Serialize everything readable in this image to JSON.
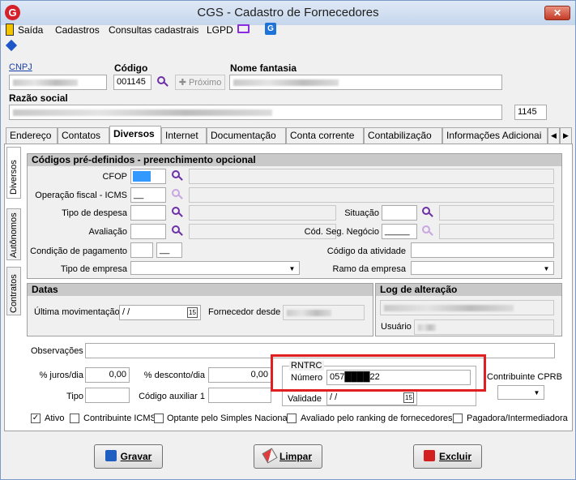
{
  "window": {
    "title": "CGS - Cadastro de Fornecedores",
    "close_label": "✕",
    "logo_letter": "G"
  },
  "menu": {
    "items": [
      "Saída",
      "Cadastros",
      "Consultas cadastrais",
      "LGPD"
    ]
  },
  "header": {
    "cnpj_label": "CNPJ",
    "codigo_label": "Código",
    "codigo_value": "001145",
    "proximo_label": "Próximo",
    "nome_fantasia_label": "Nome fantasia",
    "razao_social_label": "Razão social",
    "razao_code": "1145"
  },
  "tabs": [
    "Endereço",
    "Contatos",
    "Diversos",
    "Internet",
    "Documentação",
    "Conta corrente",
    "Contabilização",
    "Informações Adicionai"
  ],
  "side_tabs": [
    "Diversos",
    "Autônomos",
    "Contratos"
  ],
  "codigos": {
    "title": "Códigos pré-definidos - preenchimento opcional",
    "cfop": "CFOP",
    "operacao": "Operação fiscal - ICMS",
    "tipo_despesa": "Tipo de despesa",
    "avaliacao": "Avaliação",
    "condicao": "Condição de pagamento",
    "tipo_empresa": "Tipo de empresa",
    "situacao": "Situação",
    "cod_seg": "Cód. Seg. Negócio",
    "cod_atividade": "Código da atividade",
    "ramo": "Ramo da empresa"
  },
  "datas": {
    "title": "Datas",
    "ultima": "Última movimentação",
    "ultima_value": " /  /",
    "fornecedor_desde": "Fornecedor desde"
  },
  "log": {
    "title": "Log de alteração",
    "usuario": "Usuário"
  },
  "obs_label": "Observações",
  "juros_label": "% juros/dia",
  "juros_value": "0,00",
  "desconto_label": "% desconto/dia",
  "desconto_value": "0,00",
  "tipo_label": "Tipo",
  "cod_aux_label": "Código auxiliar 1",
  "rntrc": {
    "title": "RNTRC",
    "numero_label": "Número",
    "numero_value": "057████22",
    "validade_label": "Validade",
    "validade_value": " /  /"
  },
  "contribuinte_cprb": "Contribuinte CPRB",
  "checks": [
    {
      "label": "Ativo",
      "checked": true
    },
    {
      "label": "Contribuinte ICMS",
      "checked": false
    },
    {
      "label": "Optante pelo Simples Nacional",
      "checked": false
    },
    {
      "label": "Avaliado pelo ranking de fornecedores",
      "checked": false
    },
    {
      "label": "Pagadora/Intermediadora",
      "checked": false
    }
  ],
  "buttons": {
    "gravar": "Gravar",
    "limpar": "Limpar",
    "excluir": "Excluir"
  },
  "colors": {
    "highlight": "#e02020",
    "accent": "#6b2fa6",
    "cfop_fill": "#3399ff"
  }
}
